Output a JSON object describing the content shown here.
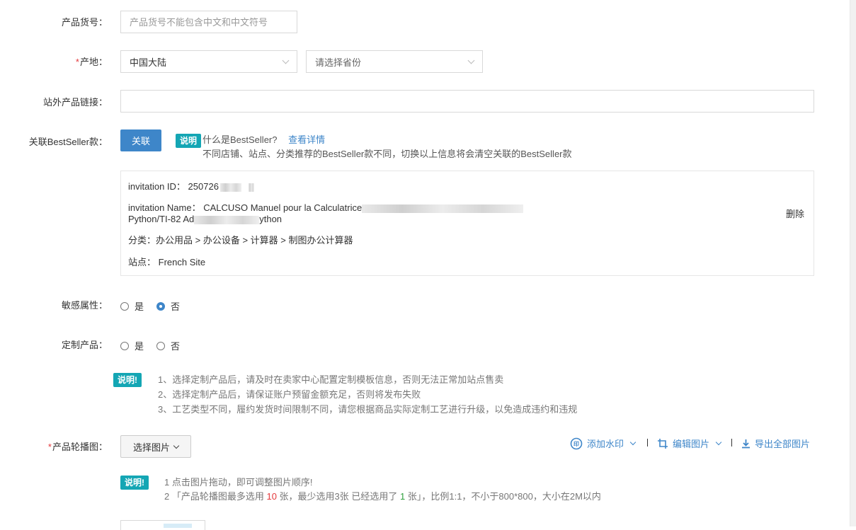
{
  "form": {
    "product_code": {
      "label": "产品货号",
      "placeholder": "产品货号不能包含中文和中文符号"
    },
    "origin": {
      "label": "产地",
      "country_value": "中国大陆",
      "province_placeholder": "请选择省份"
    },
    "external_link": {
      "label": "站外产品链接"
    },
    "bestseller": {
      "label": "关联BestSeller款",
      "button": "关联",
      "badge": "说明",
      "question": "什么是BestSeller?",
      "details_link": "查看详情",
      "hint": "不同店铺、站点、分类推荐的BestSeller款不同，切换以上信息将会清空关联的BestSeller款"
    },
    "invitation": {
      "id_label": "invitation ID：",
      "id_value": "250726",
      "name_label": "invitation Name：",
      "name_value_line1": "CALCUSO Manuel pour la Calculatrice",
      "name_value_line2_start": "Python/TI-82 Ad",
      "name_value_line2_end": "ython",
      "category_label": "分类：",
      "category_value": "办公用品 > 办公设备 > 计算器 > 制图办公计算器",
      "site_label": "站点：",
      "site_value": "French Site",
      "delete": "删除"
    },
    "sensitive": {
      "label": "敏感属性",
      "options": [
        "是",
        "否"
      ],
      "selected": "否"
    },
    "custom_product": {
      "label": "定制产品",
      "options": [
        "是",
        "否"
      ],
      "badge": "说明!",
      "notes": [
        "1、选择定制产品后，请及时在卖家中心配置定制模板信息，否则无法正常加站点售卖",
        "2、选择定制产品后，请保证账户预留金额充足，否则将发布失败",
        "3、工艺类型不同，履约发货时间限制不同，请您根据商品实际定制工艺进行升级，以免造成违约和违规"
      ]
    },
    "carousel": {
      "label": "产品轮播图",
      "select_button": "选择图片",
      "tools": {
        "watermark": "添加水印",
        "edit": "编辑图片",
        "export": "导出全部图片"
      },
      "badge": "说明!",
      "note1": "1 点击图片拖动，即可调整图片顺序!",
      "note2_a": "2 「产品轮播图最多选用 ",
      "note2_max": "10",
      "note2_b": " 张，最少选用3张 已经选用了 ",
      "note2_count": "1",
      "note2_c": " 张」，比例1:1，不小于800*800，大小在2M以内"
    }
  },
  "colors": {
    "primary": "#3e86c9",
    "badge": "#14a6b4",
    "required": "#e4393c",
    "count": "#2e9f3c"
  }
}
